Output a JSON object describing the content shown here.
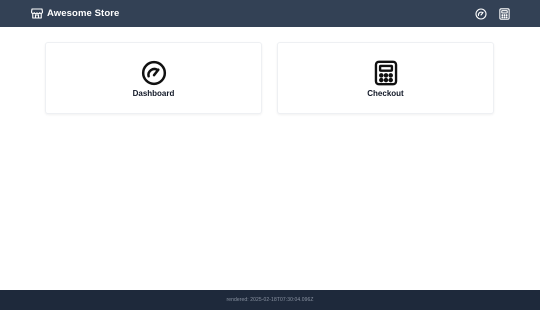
{
  "header": {
    "title": "Awesome Store",
    "brand_icon": "store-icon",
    "actions": [
      {
        "icon": "gauge-icon",
        "target": "Dashboard"
      },
      {
        "icon": "calculator-icon",
        "target": "Checkout"
      }
    ]
  },
  "cards": [
    {
      "label": "Dashboard",
      "icon": "gauge-icon"
    },
    {
      "label": "Checkout",
      "icon": "calculator-icon"
    }
  ],
  "footer": {
    "text": "rendered: 2025-02-18T07:30:04.096Z"
  },
  "colors": {
    "header_bg": "#334155",
    "footer_bg": "#1e293b",
    "card_border": "#eef0f3",
    "text": "#111827"
  }
}
